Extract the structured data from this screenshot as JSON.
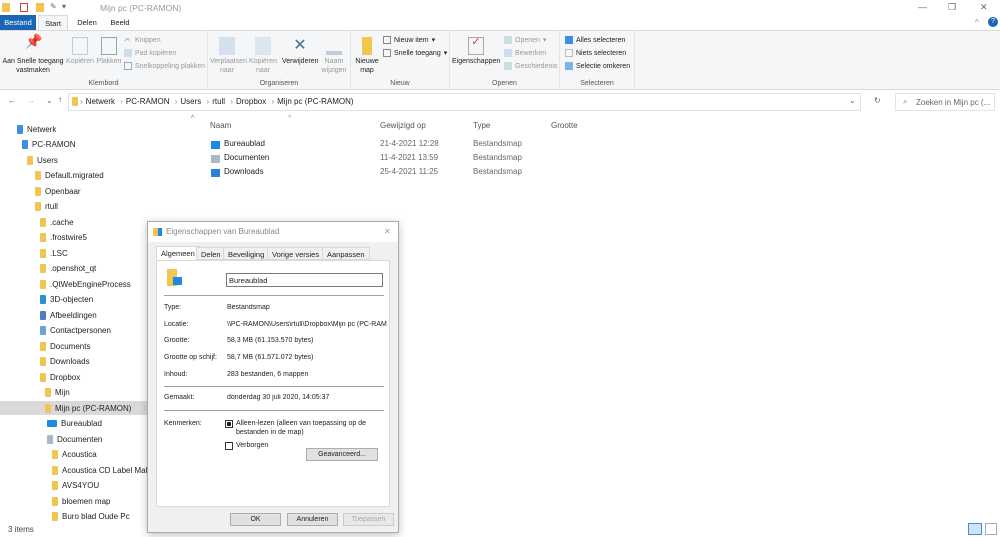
{
  "window": {
    "title": "Mijn pc (PC-RAMON)",
    "controls": {
      "minimize": "—",
      "maximize": "❐",
      "close": "✕"
    }
  },
  "ribbon_tabs": [
    "Bestand",
    "Start",
    "Delen",
    "Beeld"
  ],
  "ribbon": {
    "klembord": {
      "label": "Klembord",
      "pin": "Aan Snelle toegang vastmaken",
      "copy": "Kopiëren",
      "paste": "Plakken",
      "cut": "Knippen",
      "copy_path": "Pad kopiëren",
      "paste_shortcut": "Snelkoppeling plakken"
    },
    "organiseren": {
      "label": "Organiseren",
      "move": "Verplaatsen naar",
      "copy_to": "Kopiëren naar",
      "delete": "Verwijderen",
      "rename": "Naam wijzigen"
    },
    "nieuw": {
      "label": "Nieuw",
      "new_folder": "Nieuwe map",
      "new_item": "Nieuw item",
      "quick_access": "Snelle toegang"
    },
    "openen": {
      "label": "Openen",
      "properties": "Eigenschappen",
      "open": "Openen",
      "edit": "Bewerken",
      "history": "Geschiedenis"
    },
    "selecteren": {
      "label": "Selecteren",
      "select_all": "Alles selecteren",
      "select_none": "Niets selecteren",
      "invert": "Selectie omkeren"
    }
  },
  "address": {
    "breadcrumbs": [
      "Netwerk",
      "PC-RAMON",
      "Users",
      "rtull",
      "Dropbox",
      "Mijn pc (PC-RAMON)"
    ],
    "search_placeholder": "Zoeken in Mijn pc (..."
  },
  "tree": [
    "Netwerk",
    "PC-RAMON",
    "Users",
    "Default.migrated",
    "Openbaar",
    "rtull",
    ".cache",
    ".frostwire5",
    ".LSC",
    ".openshot_qt",
    ".QtWebEngineProcess",
    "3D-objecten",
    "Afbeeldingen",
    "Contactpersonen",
    "Documents",
    "Downloads",
    "Dropbox",
    "Mijn",
    "Mijn pc (PC-RAMON)",
    "Bureaublad",
    "Documenten",
    "Acoustica",
    "Acoustica CD Label Mak",
    "AVS4YOU",
    "bloemen map",
    "Buro blad Oude Pc"
  ],
  "columns": [
    "Naam",
    "Gewijzigd op",
    "Type",
    "Grootte"
  ],
  "files": [
    {
      "name": "Bureaublad",
      "modified": "21-4-2021 12:28",
      "type": "Bestandsmap"
    },
    {
      "name": "Documenten",
      "modified": "11-4-2021 13:59",
      "type": "Bestandsmap"
    },
    {
      "name": "Downloads",
      "modified": "25-4-2021 11:25",
      "type": "Bestandsmap"
    }
  ],
  "status": "3 items",
  "dialog": {
    "title": "Eigenschappen van Bureaublad",
    "tabs": [
      "Algemeen",
      "Delen",
      "Beveiliging",
      "Vorige versies",
      "Aanpassen"
    ],
    "name": "Bureaublad",
    "fields": [
      {
        "label": "Type:",
        "value": "Bestandsmap"
      },
      {
        "label": "Locatie:",
        "value": "\\\\PC-RAMON\\Users\\rtull\\Dropbox\\Mijn pc (PC-RAMON)"
      },
      {
        "label": "Grootte:",
        "value": "58,3 MB (61.153.570 bytes)"
      },
      {
        "label": "Grootte op schijf:",
        "value": "58,7 MB (61.571.072 bytes)"
      },
      {
        "label": "Inhoud:",
        "value": "283 bestanden, 6 mappen"
      }
    ],
    "created_label": "Gemaakt:",
    "created": "donderdag 30 juli 2020, 14:05:37",
    "attributes_label": "Kenmerken:",
    "readonly": "Alleen-lezen (alleen van toepassing op de bestanden in de map)",
    "readonly_state": "indeterminate",
    "hidden": "Verborgen",
    "hidden_checked": false,
    "advanced": "Geavanceerd...",
    "ok": "OK",
    "cancel": "Annuleren",
    "apply": "Toepassen"
  }
}
